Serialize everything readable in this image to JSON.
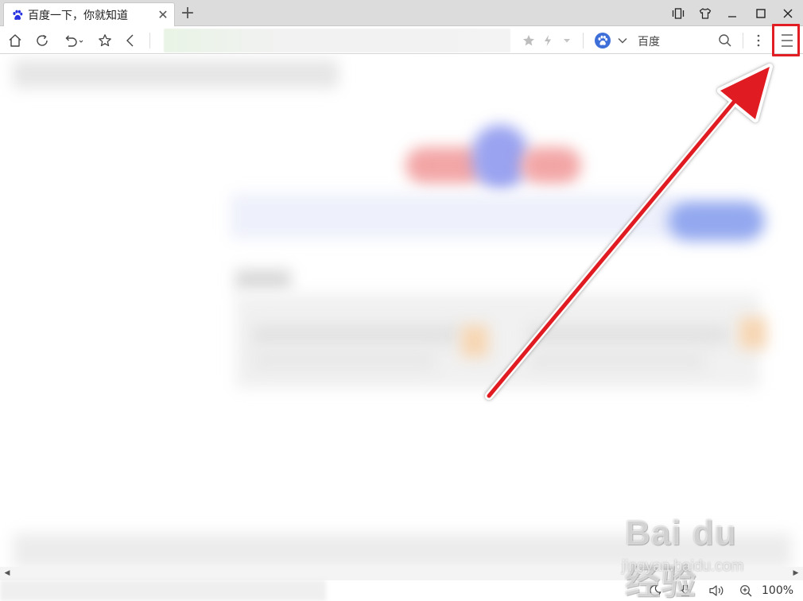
{
  "tab": {
    "title": "百度一下，你就知道",
    "favicon": "baidu-paw-icon",
    "close_glyph": "✕",
    "new_tab_glyph": "+"
  },
  "window_controls": [
    "reader-mode-icon",
    "skin-icon",
    "minimize-icon",
    "maximize-icon",
    "close-icon"
  ],
  "toolbar": {
    "nav_icons": [
      "home-icon",
      "refresh-icon",
      "undo-icon",
      "favorite-icon",
      "back-icon"
    ],
    "address_icons": [
      "bookmark-star-icon",
      "lightning-icon",
      "dropdown-icon"
    ],
    "search_engine": {
      "label": "百度",
      "logo_glyph": "🐾"
    },
    "more_icon": "vertical-dots-icon",
    "menu_icon": "hamburger-menu-icon"
  },
  "annotation": {
    "highlight_color": "#e01e24",
    "arrow_color": "#e01e24"
  },
  "statusbar": {
    "icons": [
      "night-mode-icon",
      "download-icon",
      "volume-icon",
      "zoom-in-icon"
    ],
    "zoom": "100%"
  },
  "watermark": {
    "brand": "Bai du 经验",
    "url": "jingyan.baidu.com"
  }
}
